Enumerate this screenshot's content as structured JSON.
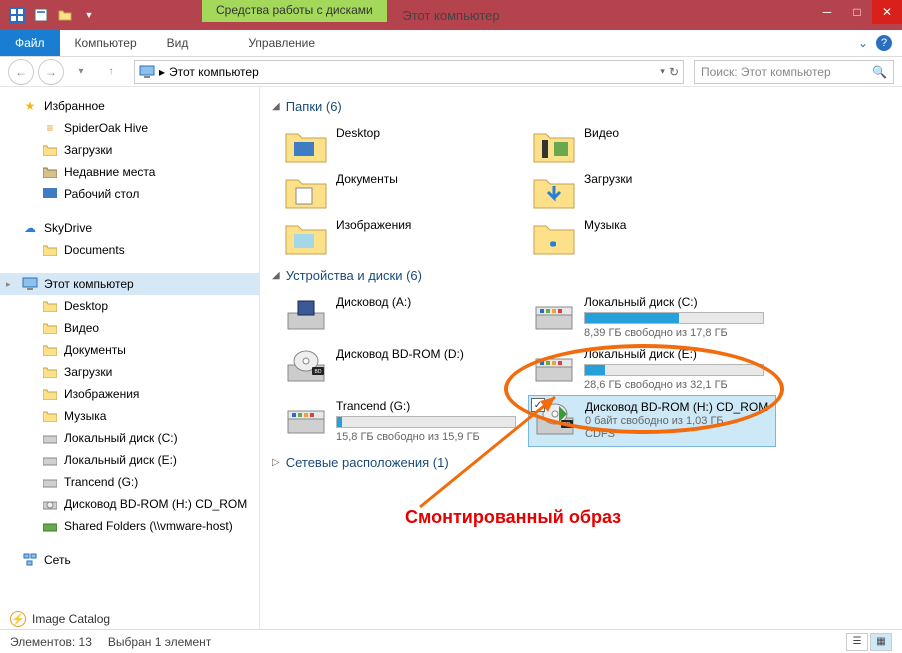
{
  "window": {
    "title": "Этот компьютер",
    "contextual_tab": "Средства работы с дисками"
  },
  "ribbon": {
    "file": "Файл",
    "tabs": [
      "Компьютер",
      "Вид"
    ],
    "contextual": "Управление"
  },
  "nav": {
    "breadcrumb": "Этот компьютер",
    "search_placeholder": "Поиск: Этот компьютер"
  },
  "navpane": {
    "favorites": {
      "label": "Избранное",
      "items": [
        "SpiderOak Hive",
        "Загрузки",
        "Недавние места",
        "Рабочий стол"
      ]
    },
    "skydrive": {
      "label": "SkyDrive",
      "items": [
        "Documents"
      ]
    },
    "thispc": {
      "label": "Этот компьютер",
      "items": [
        "Desktop",
        "Видео",
        "Документы",
        "Загрузки",
        "Изображения",
        "Музыка",
        "Локальный диск (C:)",
        "Локальный диск (E:)",
        "Trancend (G:)",
        "Дисковод BD-ROM (H:) CD_ROM",
        "Shared Folders (\\\\vmware-host)"
      ]
    },
    "network": {
      "label": "Сеть"
    }
  },
  "content": {
    "folders": {
      "header": "Папки (6)",
      "items": [
        "Desktop",
        "Видео",
        "Документы",
        "Загрузки",
        "Изображения",
        "Музыка"
      ]
    },
    "drives": {
      "header": "Устройства и диски (6)",
      "items": [
        {
          "name": "Дисковод (A:)",
          "type": "floppy"
        },
        {
          "name": "Локальный диск (C:)",
          "type": "hdd",
          "bar_pct": 53,
          "sub": "8,39 ГБ свободно из 17,8 ГБ"
        },
        {
          "name": "Дисковод BD-ROM (D:)",
          "type": "bd"
        },
        {
          "name": "Локальный диск (E:)",
          "type": "hdd",
          "bar_pct": 11,
          "sub": "28,6 ГБ свободно из 32,1 ГБ"
        },
        {
          "name": "Trancend (G:)",
          "type": "hdd",
          "bar_pct": 3,
          "sub": "15,8 ГБ свободно из 15,9 ГБ"
        },
        {
          "name": "Дисковод BD-ROM (H:) CD_ROM",
          "type": "bd-mounted",
          "sub": "0 байт свободно из 1,03 ГБ",
          "sub2": "CDFS",
          "selected": true
        }
      ]
    },
    "netloc": {
      "header": "Сетевые расположения (1)"
    }
  },
  "annotation": {
    "text": "Смонтированный образ"
  },
  "image_catalog": {
    "label": "Image Catalog"
  },
  "status": {
    "count": "Элементов: 13",
    "selected": "Выбран 1 элемент"
  }
}
